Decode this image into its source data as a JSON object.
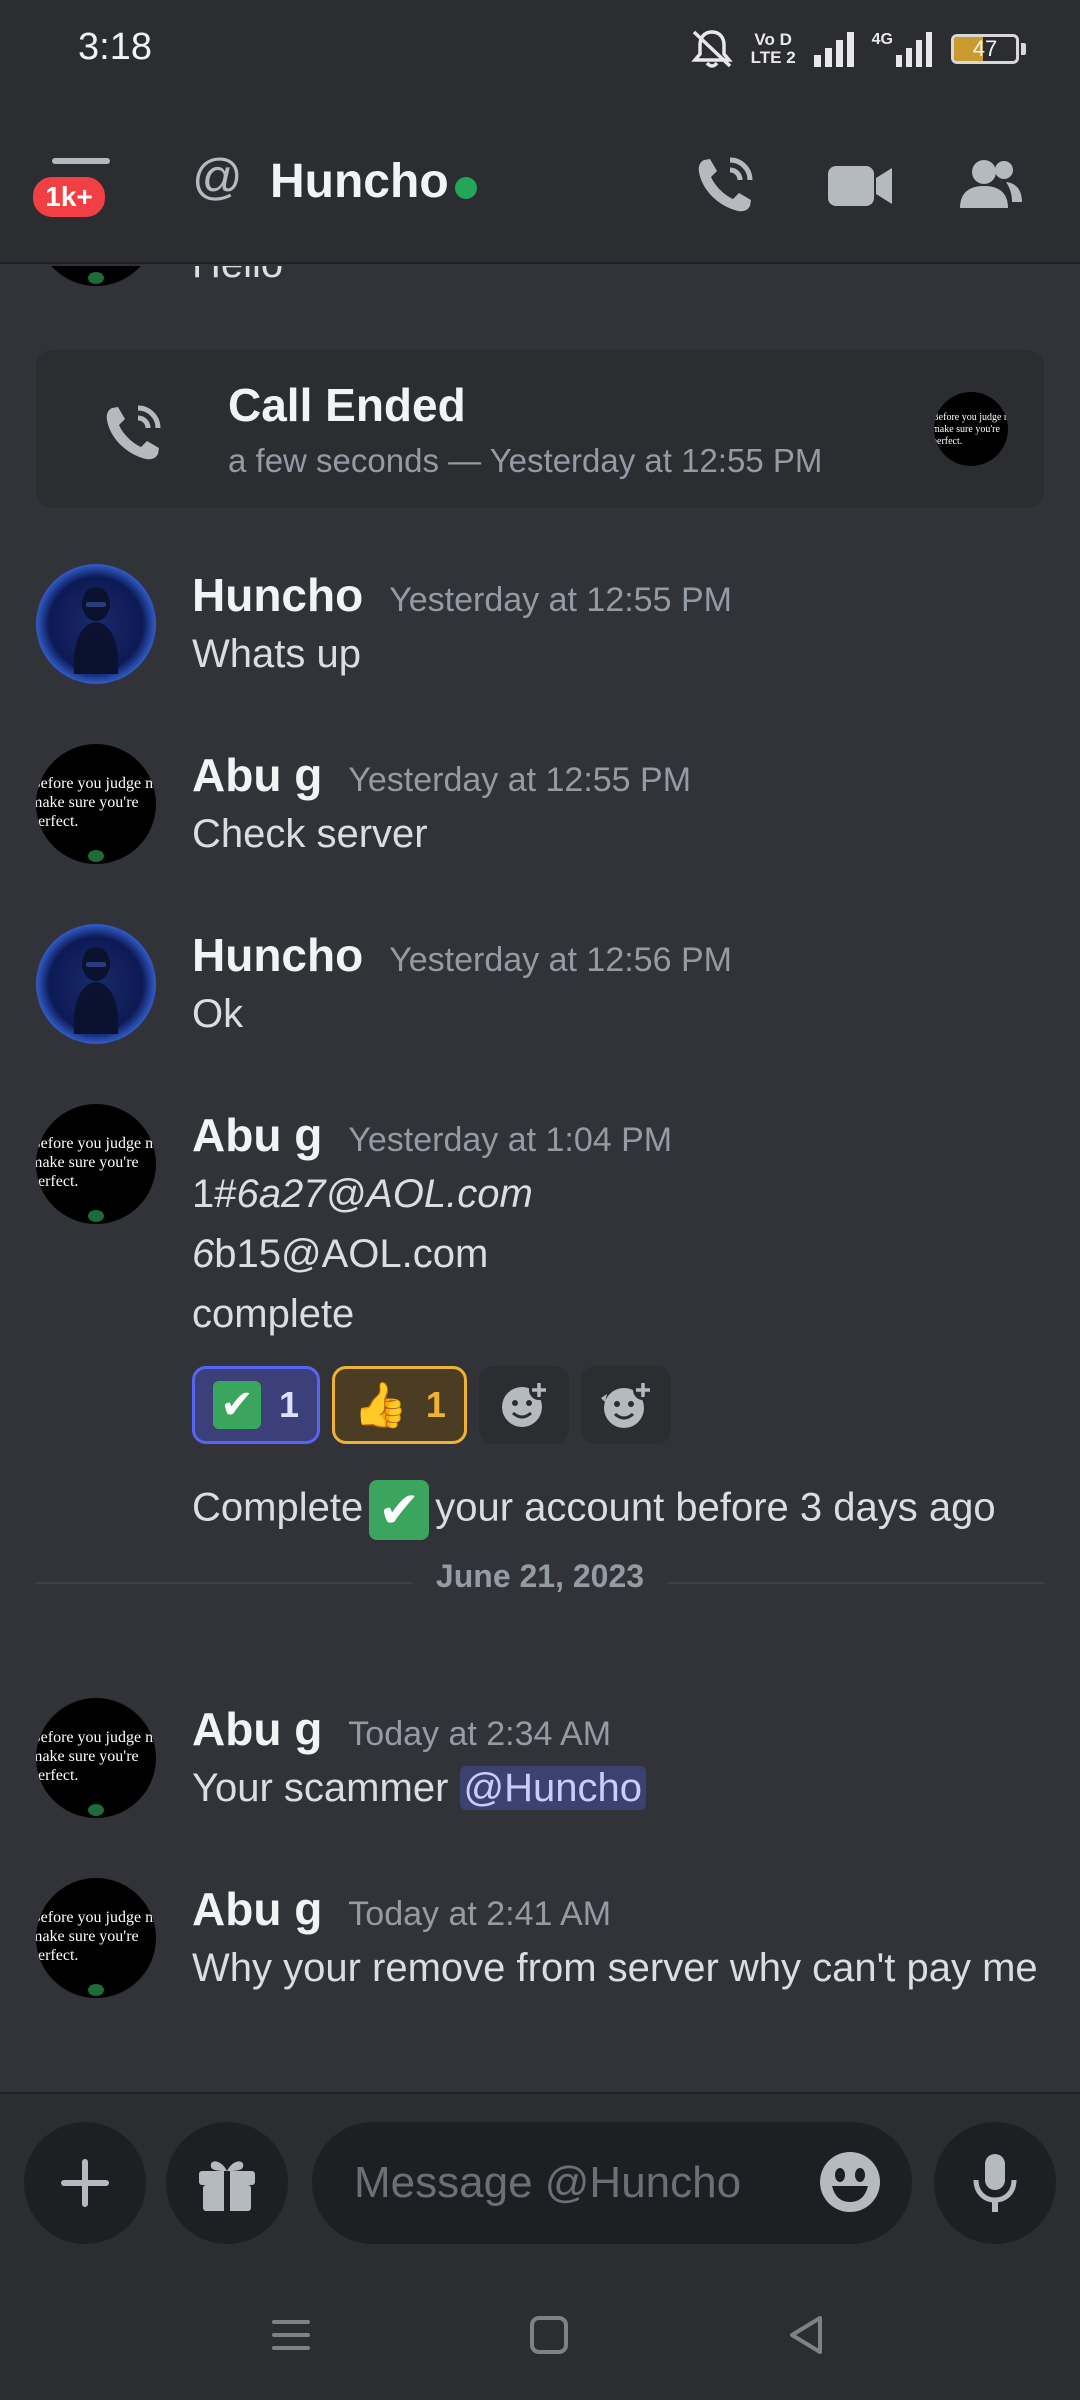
{
  "status_bar": {
    "time": "3:18",
    "network_label_top": "Vo D",
    "network_label_bottom": "LTE 2",
    "network_type": "4G",
    "battery_level": "47",
    "battery_fraction": 0.47,
    "icons": [
      "mute-bell-icon",
      "signal-icon",
      "signal-icon",
      "battery-icon"
    ]
  },
  "header": {
    "menu_badge": "1k+",
    "title": "Huncho",
    "online": true,
    "icons": [
      "hamburger-menu-icon",
      "at-sign-icon",
      "phone-icon",
      "video-camera-icon",
      "members-icon"
    ]
  },
  "call_ended": {
    "title": "Call Ended",
    "subtitle": "a few seconds — Yesterday at 12:55 PM"
  },
  "prev_message_tail": "Hello",
  "avatar_quote": "Before you judge me, make sure you're perfect.",
  "messages": [
    {
      "author": "Huncho",
      "time": "Yesterday at 12:55 PM",
      "text": "Whats up"
    },
    {
      "author": "Abu g",
      "time": "Yesterday at 12:55 PM",
      "text": "Check server"
    },
    {
      "author": "Huncho",
      "time": "Yesterday at 12:56 PM",
      "text": "Ok"
    },
    {
      "author": "Abu g",
      "time": "Yesterday at 1:04 PM",
      "lines": {
        "l1_prefix": "1#",
        "l1_italic": "6a27@AOL.com",
        "l2_italic": "6",
        "l2_rest": "b15@AOL.com",
        "l3": "complete"
      },
      "reactions": [
        {
          "emoji": "check-mark-emoji",
          "count": "1"
        },
        {
          "emoji": "thumbs-up-emoji",
          "count": "1"
        }
      ],
      "follow_up": {
        "before": "Complete",
        "after": "your account before 3 days ago"
      }
    },
    {
      "author": "Abu g",
      "time": "Today at 2:34 AM",
      "text_before": "Your scammer ",
      "mention": "@Huncho"
    },
    {
      "author": "Abu g",
      "time": "Today at 2:41 AM",
      "text": "Why your remove from server why can't pay me"
    }
  ],
  "date_divider": "June 21, 2023",
  "composer": {
    "placeholder": "Message @Huncho",
    "icons": [
      "plus-icon",
      "gift-icon",
      "emoji-icon",
      "microphone-icon"
    ]
  },
  "navbar": {
    "icons": [
      "recents-icon",
      "home-icon",
      "back-icon"
    ]
  },
  "colors": {
    "background": "#313338",
    "header_bg": "#2b2d31",
    "online": "#23a55a",
    "badge": "#f23f43",
    "mention_bg": "#3c4270"
  }
}
